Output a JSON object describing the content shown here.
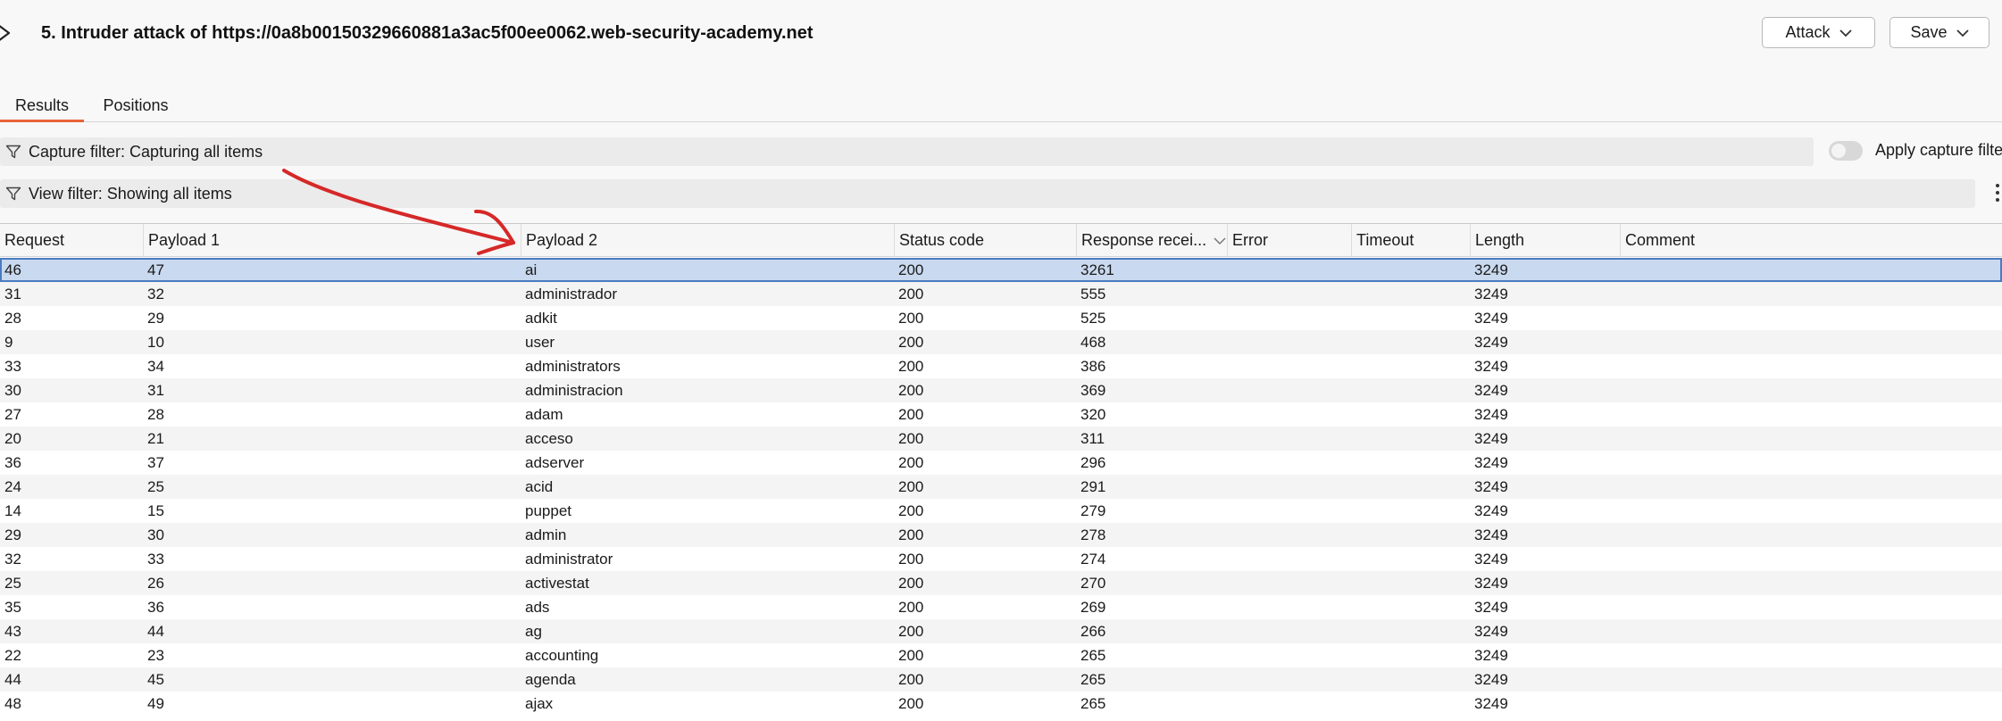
{
  "window": {
    "title": "5. Intruder attack of https://0a8b00150329660881a3ac5f00ee0062.web-security-academy.net",
    "attack_label": "Attack",
    "save_label": "Save"
  },
  "tabs": [
    {
      "label": "Results",
      "active": true
    },
    {
      "label": "Positions",
      "active": false
    }
  ],
  "filters": {
    "capture": "Capture filter: Capturing all items",
    "view": "View filter: Showing all items",
    "apply_capture_label": "Apply capture filte",
    "apply_capture_enabled": false
  },
  "table": {
    "columns": [
      "Request",
      "Payload 1",
      "Payload 2",
      "Status code",
      "Response recei...",
      "Error",
      "Timeout",
      "Length",
      "Comment"
    ],
    "selected_row": 0,
    "rows": [
      [
        "46",
        "47",
        "ai",
        "200",
        "3261",
        "",
        "",
        "3249",
        ""
      ],
      [
        "31",
        "32",
        "administrador",
        "200",
        "555",
        "",
        "",
        "3249",
        ""
      ],
      [
        "28",
        "29",
        "adkit",
        "200",
        "525",
        "",
        "",
        "3249",
        ""
      ],
      [
        "9",
        "10",
        "user",
        "200",
        "468",
        "",
        "",
        "3249",
        ""
      ],
      [
        "33",
        "34",
        "administrators",
        "200",
        "386",
        "",
        "",
        "3249",
        ""
      ],
      [
        "30",
        "31",
        "administracion",
        "200",
        "369",
        "",
        "",
        "3249",
        ""
      ],
      [
        "27",
        "28",
        "adam",
        "200",
        "320",
        "",
        "",
        "3249",
        ""
      ],
      [
        "20",
        "21",
        "acceso",
        "200",
        "311",
        "",
        "",
        "3249",
        ""
      ],
      [
        "36",
        "37",
        "adserver",
        "200",
        "296",
        "",
        "",
        "3249",
        ""
      ],
      [
        "24",
        "25",
        "acid",
        "200",
        "291",
        "",
        "",
        "3249",
        ""
      ],
      [
        "14",
        "15",
        "puppet",
        "200",
        "279",
        "",
        "",
        "3249",
        ""
      ],
      [
        "29",
        "30",
        "admin",
        "200",
        "278",
        "",
        "",
        "3249",
        ""
      ],
      [
        "32",
        "33",
        "administrator",
        "200",
        "274",
        "",
        "",
        "3249",
        ""
      ],
      [
        "25",
        "26",
        "activestat",
        "200",
        "270",
        "",
        "",
        "3249",
        ""
      ],
      [
        "35",
        "36",
        "ads",
        "200",
        "269",
        "",
        "",
        "3249",
        ""
      ],
      [
        "43",
        "44",
        "ag",
        "200",
        "266",
        "",
        "",
        "3249",
        ""
      ],
      [
        "22",
        "23",
        "accounting",
        "200",
        "265",
        "",
        "",
        "3249",
        ""
      ],
      [
        "44",
        "45",
        "agenda",
        "200",
        "265",
        "",
        "",
        "3249",
        ""
      ],
      [
        "48",
        "49",
        "ajax",
        "200",
        "265",
        "",
        "",
        "3249",
        ""
      ]
    ]
  },
  "icons": {
    "title": "intruder-icon",
    "filter": "funnel-icon",
    "dropdown": "chevron-down-icon",
    "sort": "sort-descending-icon",
    "menu": "vertical-ellipsis-icon"
  },
  "colors": {
    "tab_active_underline": "#e8643a",
    "selected_row": "#c9d9ef",
    "annotation_arrow": "#d62828"
  }
}
